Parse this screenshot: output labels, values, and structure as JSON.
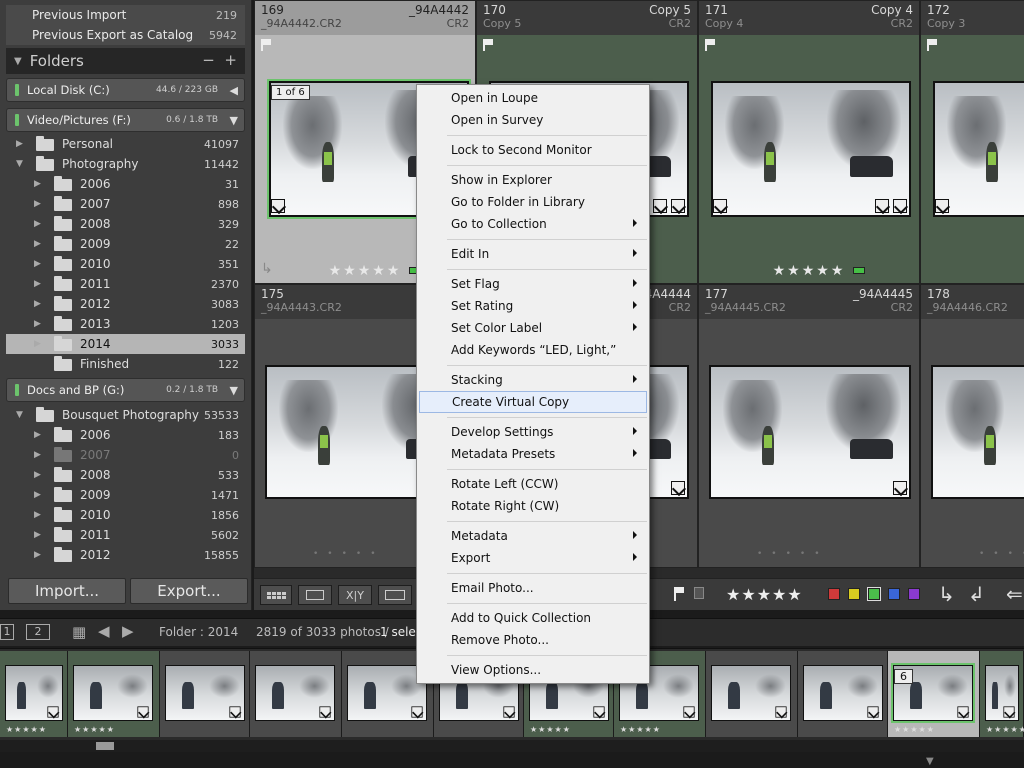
{
  "collections": [
    {
      "label": "Previous Import",
      "count": "219"
    },
    {
      "label": "Previous Export as Catalog",
      "count": "5942"
    }
  ],
  "folders_panel": {
    "title": "Folders",
    "minus": "−",
    "plus": "+"
  },
  "volumes": [
    {
      "label": "Local Disk (C:)",
      "size": "44.6 / 223 GB"
    },
    {
      "label": "Video/Pictures (F:)",
      "size": "0.6 / 1.8 TB"
    },
    {
      "label": "Docs and BP (G:)",
      "size": "0.2 / 1.8 TB"
    }
  ],
  "folders_f": [
    {
      "label": "Personal",
      "count": "41097"
    },
    {
      "label": "Photography",
      "count": "11442"
    },
    {
      "label": "2006",
      "count": "31"
    },
    {
      "label": "2007",
      "count": "898"
    },
    {
      "label": "2008",
      "count": "329"
    },
    {
      "label": "2009",
      "count": "22"
    },
    {
      "label": "2010",
      "count": "351"
    },
    {
      "label": "2011",
      "count": "2370"
    },
    {
      "label": "2012",
      "count": "3083"
    },
    {
      "label": "2013",
      "count": "1203"
    },
    {
      "label": "2014",
      "count": "3033"
    },
    {
      "label": "Finished",
      "count": "122"
    }
  ],
  "folders_g": [
    {
      "label": "Bousquet Photography",
      "count": "53533"
    },
    {
      "label": "2006",
      "count": "183"
    },
    {
      "label": "2007",
      "count": "0"
    },
    {
      "label": "2008",
      "count": "533"
    },
    {
      "label": "2009",
      "count": "1471"
    },
    {
      "label": "2010",
      "count": "1856"
    },
    {
      "label": "2011",
      "count": "5602"
    },
    {
      "label": "2012",
      "count": "15855"
    }
  ],
  "buttons": {
    "import": "Import...",
    "export": "Export..."
  },
  "grid": {
    "row1": [
      {
        "num": "169",
        "copy": "_94A4442",
        "file": "_94A4442.CR2",
        "ext": "CR2",
        "badge": "1 of 6"
      },
      {
        "num": "170",
        "copy": "Copy 5",
        "file": "Copy 5",
        "ext": "CR2"
      },
      {
        "num": "171",
        "copy": "Copy 4",
        "file": "Copy 4",
        "ext": "CR2"
      },
      {
        "num": "172",
        "copy": "Copy 3",
        "file": "Copy 3",
        "ext": "CR2"
      }
    ],
    "row2": [
      {
        "num": "175",
        "copy": "",
        "file": "_94A4443.CR2",
        "ext": ""
      },
      {
        "num": "",
        "copy": "_94A4444",
        "file": "",
        "ext": "CR2"
      },
      {
        "num": "177",
        "copy": "_94A4445",
        "file": "_94A4445.CR2",
        "ext": "CR2"
      },
      {
        "num": "178",
        "copy": "",
        "file": "_94A4446.CR2",
        "ext": ""
      }
    ],
    "stars": "★★★★★",
    "stars_partial": "★★★"
  },
  "toolbar": {
    "grid_icon": "grid-view",
    "xy": "X|Y",
    "flag_colors": [
      "#d03a3a",
      "#d8cc20",
      "#4bbf4b",
      "#3a66d8",
      "#8a3ad0"
    ]
  },
  "filmstrip": {
    "screen1": "1",
    "screen2": "2",
    "folder": "Folder : 2014",
    "count": "2819 of 3033 photos /",
    "selected": "1 selec",
    "badge6": "6",
    "stars": "★★★★★"
  },
  "menu": {
    "items": [
      {
        "label": "Open in Loupe",
        "sub": false
      },
      {
        "label": "Open in Survey",
        "sub": false
      },
      {
        "label": "Lock to Second Monitor",
        "sub": false
      },
      {
        "label": "Show in Explorer",
        "sub": false
      },
      {
        "label": "Go to Folder in Library",
        "sub": false
      },
      {
        "label": "Go to Collection",
        "sub": true
      },
      {
        "label": "Edit In",
        "sub": true
      },
      {
        "label": "Set Flag",
        "sub": true
      },
      {
        "label": "Set Rating",
        "sub": true
      },
      {
        "label": "Set Color Label",
        "sub": true
      },
      {
        "label": "Add Keywords “LED, Light,”",
        "sub": false
      },
      {
        "label": "Stacking",
        "sub": true
      },
      {
        "label": "Create Virtual Copy",
        "sub": false
      },
      {
        "label": "Develop Settings",
        "sub": true
      },
      {
        "label": "Metadata Presets",
        "sub": true
      },
      {
        "label": "Rotate Left (CCW)",
        "sub": false
      },
      {
        "label": "Rotate Right (CW)",
        "sub": false
      },
      {
        "label": "Metadata",
        "sub": true
      },
      {
        "label": "Export",
        "sub": true
      },
      {
        "label": "Email Photo...",
        "sub": false
      },
      {
        "label": "Add to Quick Collection",
        "sub": false
      },
      {
        "label": "Remove Photo...",
        "sub": false
      },
      {
        "label": "View Options...",
        "sub": false
      }
    ]
  }
}
